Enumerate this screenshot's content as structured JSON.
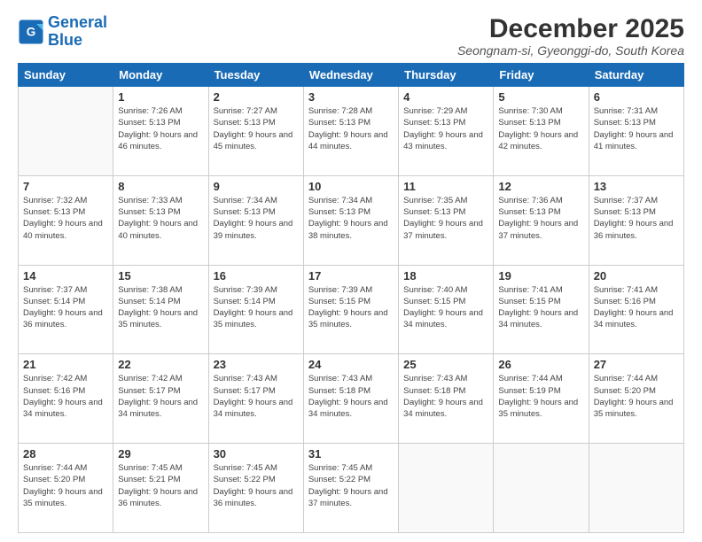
{
  "logo": {
    "text_general": "General",
    "text_blue": "Blue"
  },
  "header": {
    "month_year": "December 2025",
    "location": "Seongnam-si, Gyeonggi-do, South Korea"
  },
  "days_of_week": [
    "Sunday",
    "Monday",
    "Tuesday",
    "Wednesday",
    "Thursday",
    "Friday",
    "Saturday"
  ],
  "weeks": [
    [
      {
        "day": "",
        "sunrise": "",
        "sunset": "",
        "daylight": ""
      },
      {
        "day": "1",
        "sunrise": "Sunrise: 7:26 AM",
        "sunset": "Sunset: 5:13 PM",
        "daylight": "Daylight: 9 hours and 46 minutes."
      },
      {
        "day": "2",
        "sunrise": "Sunrise: 7:27 AM",
        "sunset": "Sunset: 5:13 PM",
        "daylight": "Daylight: 9 hours and 45 minutes."
      },
      {
        "day": "3",
        "sunrise": "Sunrise: 7:28 AM",
        "sunset": "Sunset: 5:13 PM",
        "daylight": "Daylight: 9 hours and 44 minutes."
      },
      {
        "day": "4",
        "sunrise": "Sunrise: 7:29 AM",
        "sunset": "Sunset: 5:13 PM",
        "daylight": "Daylight: 9 hours and 43 minutes."
      },
      {
        "day": "5",
        "sunrise": "Sunrise: 7:30 AM",
        "sunset": "Sunset: 5:13 PM",
        "daylight": "Daylight: 9 hours and 42 minutes."
      },
      {
        "day": "6",
        "sunrise": "Sunrise: 7:31 AM",
        "sunset": "Sunset: 5:13 PM",
        "daylight": "Daylight: 9 hours and 41 minutes."
      }
    ],
    [
      {
        "day": "7",
        "sunrise": "Sunrise: 7:32 AM",
        "sunset": "Sunset: 5:13 PM",
        "daylight": "Daylight: 9 hours and 40 minutes."
      },
      {
        "day": "8",
        "sunrise": "Sunrise: 7:33 AM",
        "sunset": "Sunset: 5:13 PM",
        "daylight": "Daylight: 9 hours and 40 minutes."
      },
      {
        "day": "9",
        "sunrise": "Sunrise: 7:34 AM",
        "sunset": "Sunset: 5:13 PM",
        "daylight": "Daylight: 9 hours and 39 minutes."
      },
      {
        "day": "10",
        "sunrise": "Sunrise: 7:34 AM",
        "sunset": "Sunset: 5:13 PM",
        "daylight": "Daylight: 9 hours and 38 minutes."
      },
      {
        "day": "11",
        "sunrise": "Sunrise: 7:35 AM",
        "sunset": "Sunset: 5:13 PM",
        "daylight": "Daylight: 9 hours and 37 minutes."
      },
      {
        "day": "12",
        "sunrise": "Sunrise: 7:36 AM",
        "sunset": "Sunset: 5:13 PM",
        "daylight": "Daylight: 9 hours and 37 minutes."
      },
      {
        "day": "13",
        "sunrise": "Sunrise: 7:37 AM",
        "sunset": "Sunset: 5:13 PM",
        "daylight": "Daylight: 9 hours and 36 minutes."
      }
    ],
    [
      {
        "day": "14",
        "sunrise": "Sunrise: 7:37 AM",
        "sunset": "Sunset: 5:14 PM",
        "daylight": "Daylight: 9 hours and 36 minutes."
      },
      {
        "day": "15",
        "sunrise": "Sunrise: 7:38 AM",
        "sunset": "Sunset: 5:14 PM",
        "daylight": "Daylight: 9 hours and 35 minutes."
      },
      {
        "day": "16",
        "sunrise": "Sunrise: 7:39 AM",
        "sunset": "Sunset: 5:14 PM",
        "daylight": "Daylight: 9 hours and 35 minutes."
      },
      {
        "day": "17",
        "sunrise": "Sunrise: 7:39 AM",
        "sunset": "Sunset: 5:15 PM",
        "daylight": "Daylight: 9 hours and 35 minutes."
      },
      {
        "day": "18",
        "sunrise": "Sunrise: 7:40 AM",
        "sunset": "Sunset: 5:15 PM",
        "daylight": "Daylight: 9 hours and 34 minutes."
      },
      {
        "day": "19",
        "sunrise": "Sunrise: 7:41 AM",
        "sunset": "Sunset: 5:15 PM",
        "daylight": "Daylight: 9 hours and 34 minutes."
      },
      {
        "day": "20",
        "sunrise": "Sunrise: 7:41 AM",
        "sunset": "Sunset: 5:16 PM",
        "daylight": "Daylight: 9 hours and 34 minutes."
      }
    ],
    [
      {
        "day": "21",
        "sunrise": "Sunrise: 7:42 AM",
        "sunset": "Sunset: 5:16 PM",
        "daylight": "Daylight: 9 hours and 34 minutes."
      },
      {
        "day": "22",
        "sunrise": "Sunrise: 7:42 AM",
        "sunset": "Sunset: 5:17 PM",
        "daylight": "Daylight: 9 hours and 34 minutes."
      },
      {
        "day": "23",
        "sunrise": "Sunrise: 7:43 AM",
        "sunset": "Sunset: 5:17 PM",
        "daylight": "Daylight: 9 hours and 34 minutes."
      },
      {
        "day": "24",
        "sunrise": "Sunrise: 7:43 AM",
        "sunset": "Sunset: 5:18 PM",
        "daylight": "Daylight: 9 hours and 34 minutes."
      },
      {
        "day": "25",
        "sunrise": "Sunrise: 7:43 AM",
        "sunset": "Sunset: 5:18 PM",
        "daylight": "Daylight: 9 hours and 34 minutes."
      },
      {
        "day": "26",
        "sunrise": "Sunrise: 7:44 AM",
        "sunset": "Sunset: 5:19 PM",
        "daylight": "Daylight: 9 hours and 35 minutes."
      },
      {
        "day": "27",
        "sunrise": "Sunrise: 7:44 AM",
        "sunset": "Sunset: 5:20 PM",
        "daylight": "Daylight: 9 hours and 35 minutes."
      }
    ],
    [
      {
        "day": "28",
        "sunrise": "Sunrise: 7:44 AM",
        "sunset": "Sunset: 5:20 PM",
        "daylight": "Daylight: 9 hours and 35 minutes."
      },
      {
        "day": "29",
        "sunrise": "Sunrise: 7:45 AM",
        "sunset": "Sunset: 5:21 PM",
        "daylight": "Daylight: 9 hours and 36 minutes."
      },
      {
        "day": "30",
        "sunrise": "Sunrise: 7:45 AM",
        "sunset": "Sunset: 5:22 PM",
        "daylight": "Daylight: 9 hours and 36 minutes."
      },
      {
        "day": "31",
        "sunrise": "Sunrise: 7:45 AM",
        "sunset": "Sunset: 5:22 PM",
        "daylight": "Daylight: 9 hours and 37 minutes."
      },
      {
        "day": "",
        "sunrise": "",
        "sunset": "",
        "daylight": ""
      },
      {
        "day": "",
        "sunrise": "",
        "sunset": "",
        "daylight": ""
      },
      {
        "day": "",
        "sunrise": "",
        "sunset": "",
        "daylight": ""
      }
    ]
  ]
}
